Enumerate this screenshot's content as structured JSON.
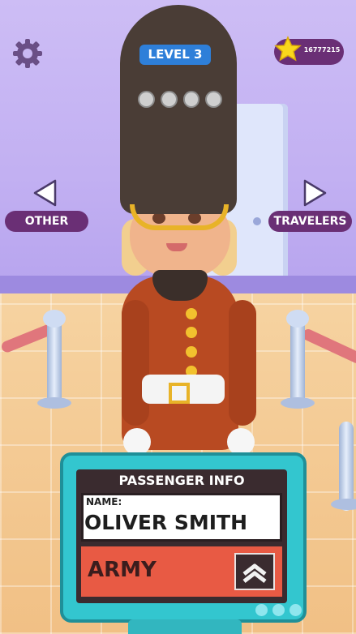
{
  "hud": {
    "level_label": "LEVEL 3",
    "coins": "16777215",
    "progress_dots": 4,
    "icons": {
      "settings": "gear-icon",
      "currency": "star-icon"
    }
  },
  "nav": {
    "left_label": "OTHER",
    "right_label": "TRAVELERS",
    "left_icon": "arrow-left-icon",
    "right_icon": "arrow-right-icon"
  },
  "passenger": {
    "panel_title": "PASSENGER INFO",
    "name_label": "NAME:",
    "name": "OLIVER SMITH",
    "occupation": "ARMY",
    "rank_icon": "chevron-rank-icon"
  },
  "colors": {
    "hud_badge": "#2e7fd9",
    "pill": "#6a2f75",
    "panel": "#33c6cf",
    "occupation_bg": "#e85a44"
  }
}
